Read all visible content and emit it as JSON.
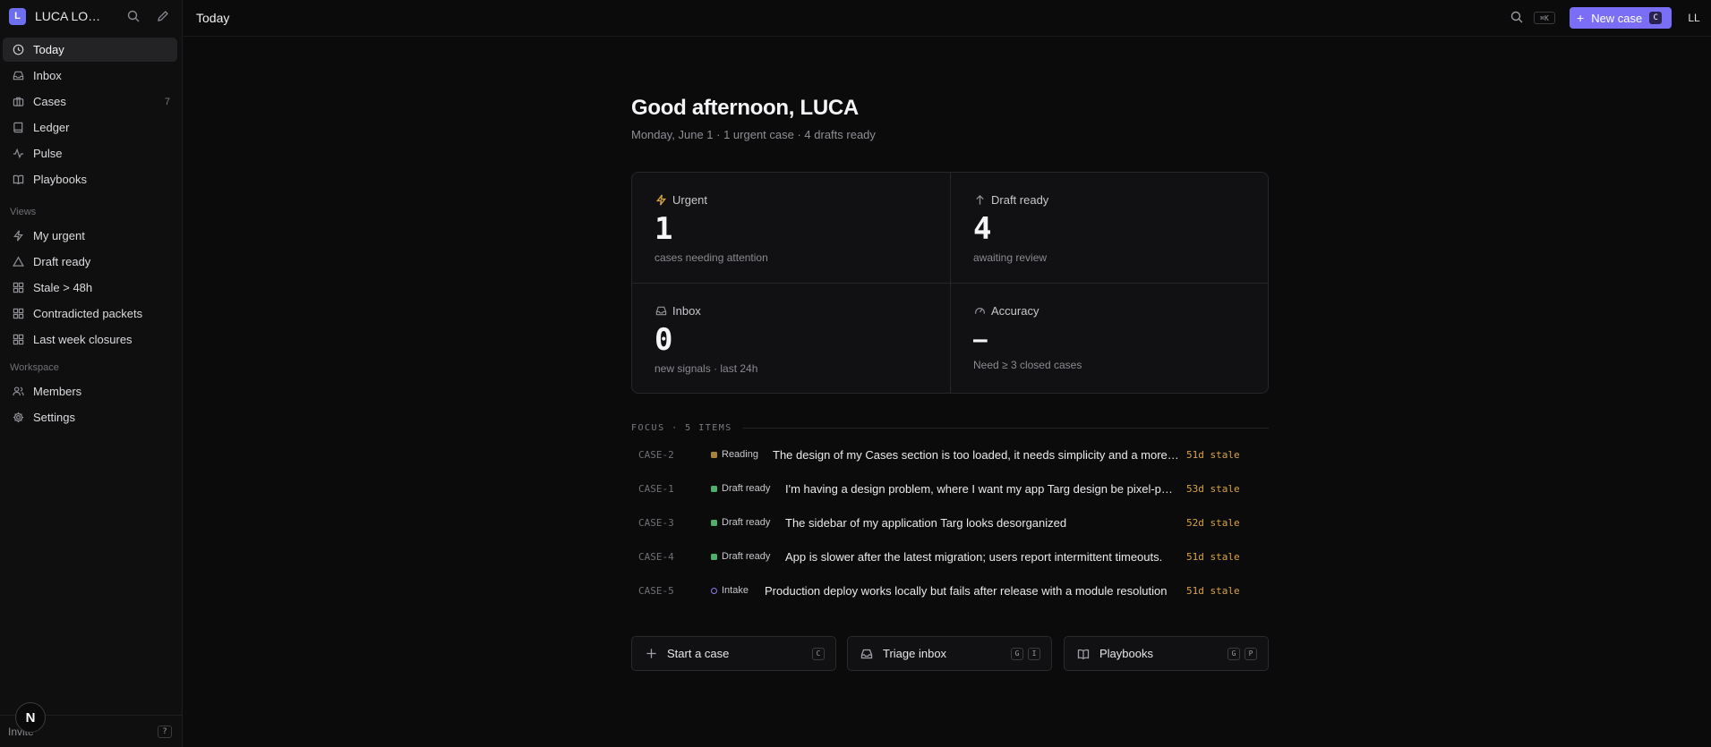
{
  "workspace": {
    "logo_letter": "L",
    "name": "LUCA LONG...",
    "search_icon": "search-icon",
    "compose_icon": "pencil-icon"
  },
  "sidebar": {
    "nav": [
      {
        "label": "Today",
        "icon": "clock-icon",
        "active": true,
        "count": ""
      },
      {
        "label": "Inbox",
        "icon": "inbox-icon",
        "count": ""
      },
      {
        "label": "Cases",
        "icon": "briefcase-icon",
        "count": "7"
      },
      {
        "label": "Ledger",
        "icon": "book-icon",
        "count": ""
      },
      {
        "label": "Pulse",
        "icon": "pulse-icon",
        "count": ""
      },
      {
        "label": "Playbooks",
        "icon": "open-book-icon",
        "count": ""
      }
    ],
    "views_label": "Views",
    "views": [
      {
        "label": "My urgent",
        "icon": "bolt-icon"
      },
      {
        "label": "Draft ready",
        "icon": "triangle-icon"
      },
      {
        "label": "Stale > 48h",
        "icon": "grid-icon"
      },
      {
        "label": "Contradicted packets",
        "icon": "grid-icon"
      },
      {
        "label": "Last week closures",
        "icon": "grid-icon"
      }
    ],
    "workspace_label": "Workspace",
    "workspace_items": [
      {
        "label": "Members",
        "icon": "users-icon"
      },
      {
        "label": "Settings",
        "icon": "gear-icon"
      }
    ],
    "footer": {
      "invite": "Invite",
      "help_key": "?",
      "badge": "N"
    }
  },
  "topbar": {
    "title": "Today",
    "search_kbd": "⌘K",
    "new_case_label": "New case",
    "new_case_key": "C",
    "avatar": "LL"
  },
  "main": {
    "greeting": "Good afternoon, LUCA",
    "subline": "Monday, June 1 · 1 urgent case · 4 drafts ready",
    "stats": [
      {
        "label": "Urgent",
        "icon": "bolt-icon",
        "value": "1",
        "sub": "cases needing attention",
        "color": "#d9a441"
      },
      {
        "label": "Draft ready",
        "icon": "arrow-up-icon",
        "value": "4",
        "sub": "awaiting review",
        "color": "#8f8f95"
      },
      {
        "label": "Inbox",
        "icon": "inbox-icon",
        "value": "0",
        "sub": "new signals · last 24h",
        "color": "#8f8f95"
      },
      {
        "label": "Accuracy",
        "icon": "gauge-icon",
        "value": "–",
        "sub": "Need ≥ 3 closed cases",
        "color": "#8f8f95"
      }
    ],
    "focus_label": "FOCUS · 5 ITEMS",
    "focus": [
      {
        "id": "CASE-2",
        "status": "Reading",
        "status_color": "#a8843a",
        "title": "The design of my Cases section is too loaded, it needs simplicity and a more gui",
        "stale": "51d stale"
      },
      {
        "id": "CASE-1",
        "status": "Draft ready",
        "status_color": "#4caf6a",
        "title": "I'm having a design problem, where I want my app Targ design be pixel-perfect…",
        "stale": "53d stale"
      },
      {
        "id": "CASE-3",
        "status": "Draft ready",
        "status_color": "#4caf6a",
        "title": "The sidebar of my application Targ looks desorganized",
        "stale": "52d stale"
      },
      {
        "id": "CASE-4",
        "status": "Draft ready",
        "status_color": "#4caf6a",
        "title": "App is slower after the latest migration; users report intermittent timeouts.",
        "stale": "51d stale"
      },
      {
        "id": "CASE-5",
        "status": "Intake",
        "status_color": "#8a7ef0",
        "title": "Production deploy works locally but fails after release with a module resolution",
        "stale": "51d stale"
      }
    ],
    "actions": [
      {
        "label": "Start a case",
        "icon": "plus-icon",
        "keys": [
          "C"
        ]
      },
      {
        "label": "Triage inbox",
        "icon": "inbox-icon",
        "keys": [
          "G",
          "I"
        ]
      },
      {
        "label": "Playbooks",
        "icon": "open-book-icon",
        "keys": [
          "G",
          "P"
        ]
      }
    ]
  }
}
